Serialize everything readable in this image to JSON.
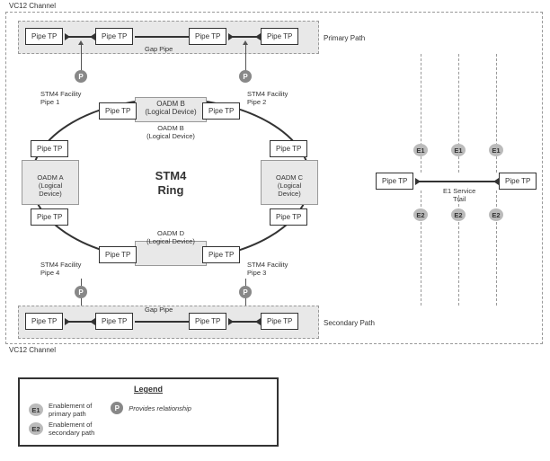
{
  "labels": {
    "vc12_top": "VC12 Channel",
    "vc12_bottom": "VC12 Channel",
    "primary_path": "Primary Path",
    "secondary_path": "Secondary Path",
    "gap_pipe_top": "Gap Pipe",
    "gap_pipe_bottom": "Gap Pipe",
    "stm4_pipe1": "STM4 Facility\nPipe 1",
    "stm4_pipe2": "STM4 Facility\nPipe 2",
    "stm4_pipe3": "STM4 Facility\nPipe 3",
    "stm4_pipe4": "STM4 Facility\nPipe 4",
    "center_title_1": "STM4",
    "center_title_2": "Ring",
    "e1_service": "E1 Service\nTrail",
    "pipe_tp": "Pipe TP"
  },
  "oadm": {
    "a": "OADM A\n(Logical Device)",
    "b": "OADM B\n(Logical Device)",
    "c": "OADM C\n(Logical Device)",
    "d": "OADM D\n(Logical Device)"
  },
  "badges": {
    "P": "P",
    "E1": "E1",
    "E2": "E2"
  },
  "legend": {
    "title": "Legend",
    "e1": "Enablement of\nprimary path",
    "e2": "Enablement of\nsecondary path",
    "p": "Provides relationship"
  },
  "chart_data": {
    "type": "diagram",
    "title": "STM4 Ring",
    "outer_container": "VC12 Channel dashed boundary",
    "paths": [
      {
        "name": "Primary Path",
        "nodes": [
          "Pipe TP",
          "Pipe TP",
          "Gap Pipe",
          "Pipe TP",
          "Pipe TP"
        ],
        "position": "top"
      },
      {
        "name": "Secondary Path",
        "nodes": [
          "Pipe TP",
          "Pipe TP",
          "Gap Pipe",
          "Pipe TP",
          "Pipe TP"
        ],
        "position": "bottom"
      }
    ],
    "ring_devices": [
      "OADM A (Logical Device)",
      "OADM B (Logical Device)",
      "OADM C (Logical Device)",
      "OADM D (Logical Device)"
    ],
    "ring_pipes": [
      "STM4 Facility Pipe 1",
      "STM4 Facility Pipe 2",
      "STM4 Facility Pipe 3",
      "STM4 Facility Pipe 4"
    ],
    "ring_tp_count": 8,
    "provides_links": [
      {
        "from": "ring top-left Pipe TP area",
        "to": "Primary Path node 2",
        "label": "P"
      },
      {
        "from": "ring top-right Pipe TP area",
        "to": "Primary Path node 3",
        "label": "P"
      },
      {
        "from": "ring bottom-left Pipe TP area",
        "to": "Secondary Path node 2",
        "label": "P"
      },
      {
        "from": "ring bottom-right Pipe TP area",
        "to": "Secondary Path node 3",
        "label": "P"
      }
    ],
    "service_trail": {
      "name": "E1 Service Trail",
      "endpoints": [
        "Pipe TP",
        "Pipe TP"
      ],
      "enablement_top": [
        "E1",
        "E1",
        "E1"
      ],
      "enablement_bottom": [
        "E2",
        "E2",
        "E2"
      ]
    },
    "legend": [
      {
        "symbol": "E1",
        "meaning": "Enablement of primary path"
      },
      {
        "symbol": "E2",
        "meaning": "Enablement of secondary path"
      },
      {
        "symbol": "P",
        "meaning": "Provides relationship"
      }
    ]
  }
}
